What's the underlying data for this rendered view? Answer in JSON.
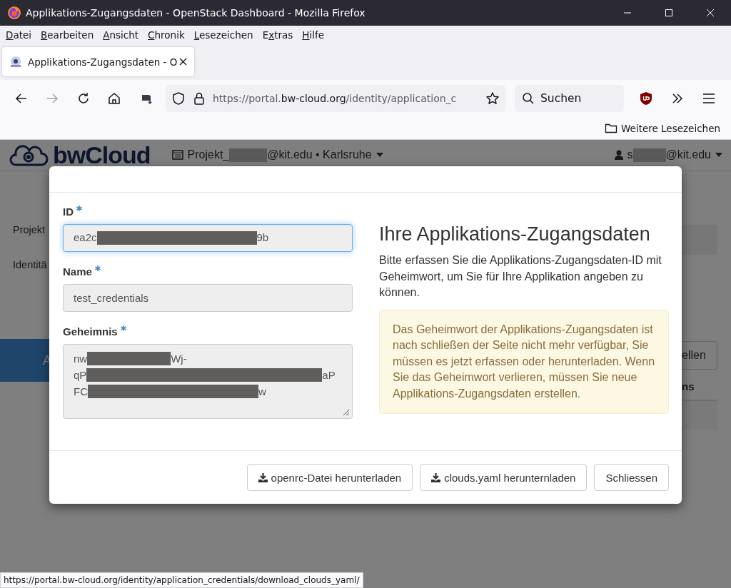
{
  "window": {
    "title": "Applikations-Zugangsdaten - OpenStack Dashboard - Mozilla Firefox"
  },
  "menu": [
    {
      "key": "D",
      "after": "atei"
    },
    {
      "key": "B",
      "after": "earbeiten"
    },
    {
      "key": "A",
      "after": "nsicht"
    },
    {
      "key": "C",
      "after": "hronik"
    },
    {
      "key": "L",
      "after": "esezeichen"
    },
    {
      "before": "E",
      "key": "x",
      "after": "tras"
    },
    {
      "key": "H",
      "after": "ilfe"
    }
  ],
  "tabs": [
    {
      "label": "Applikations-Zugangsdaten - O",
      "selected": true
    }
  ],
  "address_bar": {
    "prefix": "https://portal.",
    "domain": "bw-cloud.org",
    "path": "/identity/application_c"
  },
  "search": {
    "placeholder": "Suchen"
  },
  "bookmarks": [
    {
      "label": "Weitere Lesezeichen"
    }
  ],
  "page": {
    "logo": "bwCloud",
    "project": {
      "start": "Projekt_",
      "end": "@kit.edu • Karlsruhe"
    },
    "user": {
      "start": "s",
      "end": "@kit.edu"
    },
    "sidebar": [
      "Projekt",
      "Identitä"
    ],
    "active_item": "A",
    "button": "ellen",
    "column_header": "ns"
  },
  "modal": {
    "fields": [
      {
        "label": "ID",
        "required": true,
        "kind": "input",
        "focused": true,
        "lines": [
          {
            "start": "ea2c",
            "end": "9b"
          }
        ]
      },
      {
        "label": "Name",
        "required": true,
        "kind": "input",
        "focused": false,
        "lines": [
          {
            "start": "test_credentials"
          }
        ]
      },
      {
        "label": "Geheimnis",
        "required": true,
        "kind": "textarea",
        "focused": false,
        "lines": [
          {
            "start": "nw",
            "end": "Wj-"
          },
          {
            "start": "qP",
            "end": "aP"
          },
          {
            "start": "FC",
            "end": "w"
          }
        ]
      }
    ],
    "heading": "Ihre Applikations-Zugangsdaten",
    "text": "Bitte erfassen Sie die Applikations-Zugangsdaten-ID mit Geheimwort, um Sie für Ihre Applikation angeben zu können.",
    "warning": "Das Geheimwort der Applikations-Zugangsdaten ist nach schließen der Seite nicht mehr verfügbar, Sie müssen es jetzt erfassen oder herunterladen. Wenn Sie das Geheimwort verlieren, müssen Sie neue Applikations-Zugangsdaten erstellen.",
    "buttons": [
      {
        "label": "openrc-Datei herunterladen",
        "kind": "download"
      },
      {
        "label": "clouds.yaml herunternladen",
        "kind": "download"
      },
      {
        "label": "Schliessen",
        "kind": "close"
      }
    ]
  },
  "status_bar": {
    "url": "https://portal.bw-cloud.org/identity/application_credentials/download_clouds_yaml/"
  }
}
